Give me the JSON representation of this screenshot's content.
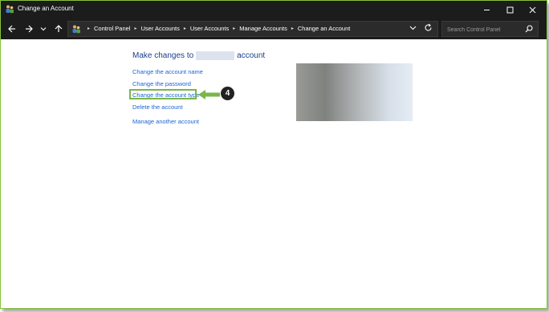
{
  "window": {
    "title": "Change an Account",
    "icons": {
      "app": "users-icon",
      "minimize": "minimize-icon",
      "maximize": "maximize-icon",
      "close": "close-icon"
    }
  },
  "nav": {
    "back_icon": "back-arrow-icon",
    "forward_icon": "forward-arrow-icon",
    "recent_icon": "chevron-down-icon",
    "up_icon": "up-arrow-icon",
    "breadcrumbs": [
      "Control Panel",
      "User Accounts",
      "User Accounts",
      "Manage Accounts",
      "Change an Account"
    ],
    "search_placeholder": "Search Control Panel"
  },
  "main": {
    "heading_prefix": "Make changes to",
    "heading_suffix": "account",
    "links": {
      "change_name": "Change the account name",
      "change_password": "Change the password",
      "change_type": "Change the account type",
      "delete_account": "Delete the account",
      "manage_another": "Manage another account"
    },
    "annotation": {
      "step_number": "4",
      "color": "#7ab648"
    }
  },
  "colors": {
    "accent_link": "#1a66d2",
    "heading": "#1a3e8c",
    "chrome": "#1c1c1c"
  }
}
